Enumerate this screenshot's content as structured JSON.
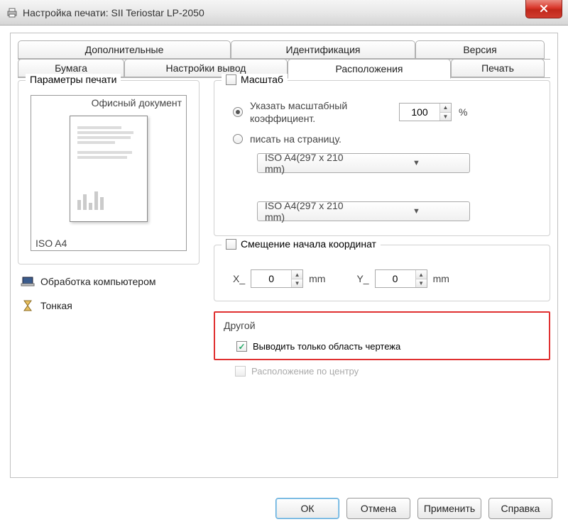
{
  "window": {
    "title": "Настройка печати: SII Teriostar LP-2050"
  },
  "tabs": {
    "row1": [
      {
        "label": "Дополнительные"
      },
      {
        "label": "Идентификация"
      },
      {
        "label": "Версия"
      }
    ],
    "row2": [
      {
        "label": "Бумага"
      },
      {
        "label": "Настройки вывод"
      },
      {
        "label": "Расположения",
        "active": true
      },
      {
        "label": "Печать"
      }
    ]
  },
  "left": {
    "group_title": "Параметры печати",
    "preview_top": "Офисный документ",
    "preview_bottom": "ISO A4",
    "items": [
      {
        "label": "Обработка компьютером"
      },
      {
        "label": "Тонкая"
      }
    ]
  },
  "scale": {
    "group_title": "Масштаб",
    "option_factor": "Указать масштабный коэффициент.",
    "option_fit": "писать на страницу.",
    "factor_value": "100",
    "factor_unit": "%",
    "page_size_1": "ISO A4(297 x 210 mm)",
    "page_size_2": "ISO A4(297 x 210 mm)"
  },
  "offset": {
    "group_title": "Смещение начала координат",
    "x_label": "X_",
    "x_value": "0",
    "x_unit": "mm",
    "y_label": "Y_",
    "y_value": "0",
    "y_unit": "mm"
  },
  "other": {
    "group_title": "Другой",
    "opt_drawing_area": "Выводить только область чертежа",
    "opt_center": "Расположение по центру"
  },
  "buttons": {
    "ok": "ОК",
    "cancel": "Отмена",
    "apply": "Применить",
    "help": "Справка"
  }
}
